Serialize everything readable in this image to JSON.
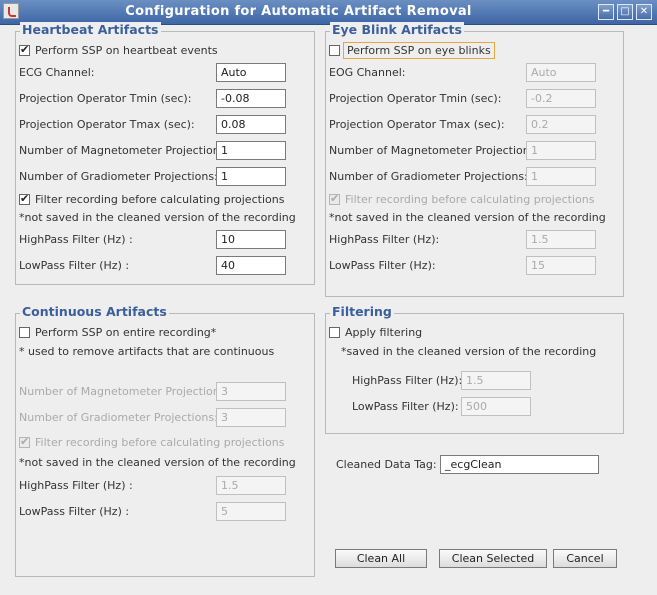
{
  "window": {
    "title": "Configuration for Automatic Artifact Removal"
  },
  "heartbeat": {
    "title": "Heartbeat Artifacts",
    "perform_label": "Perform SSP on heartbeat events",
    "ecg_channel_label": "ECG Channel:",
    "ecg_channel_value": "Auto",
    "tmin_label": "Projection Operator Tmin (sec):",
    "tmin_value": "-0.08",
    "tmax_label": "Projection Operator Tmax (sec):",
    "tmax_value": "0.08",
    "mag_label": "Number of Magnetometer Projections:",
    "mag_value": "1",
    "grad_label": "Number of Gradiometer Projections:",
    "grad_value": "1",
    "filter_label": "Filter recording before calculating projections",
    "note": "*not saved in the cleaned version of the recording",
    "highpass_label": "HighPass Filter (Hz) :",
    "highpass_value": "10",
    "lowpass_label": "LowPass Filter (Hz) :",
    "lowpass_value": "40"
  },
  "eyeblink": {
    "title": "Eye Blink Artifacts",
    "perform_label": "Perform SSP on eye blinks",
    "eog_channel_label": "EOG Channel:",
    "eog_channel_value": "Auto",
    "tmin_label": "Projection Operator Tmin (sec):",
    "tmin_value": "-0.2",
    "tmax_label": "Projection Operator Tmax (sec):",
    "tmax_value": "0.2",
    "mag_label": "Number of Magnetometer Projections:",
    "mag_value": "1",
    "grad_label": "Number of Gradiometer Projections:",
    "grad_value": "1",
    "filter_label": "Filter recording before calculating projections",
    "note": "*not saved in the cleaned version of the recording",
    "highpass_label": "HighPass Filter (Hz):",
    "highpass_value": "1.5",
    "lowpass_label": "LowPass Filter (Hz):",
    "lowpass_value": "15"
  },
  "continuous": {
    "title": "Continuous Artifacts",
    "perform_label": "Perform SSP on entire recording*",
    "used_note": "* used to remove artifacts that are continuous",
    "mag_label": "Number of Magnetometer Projections:",
    "mag_value": "3",
    "grad_label": "Number of Gradiometer Projections:",
    "grad_value": "3",
    "filter_label": "Filter recording before calculating projections",
    "note": "*not saved in the cleaned version of the recording",
    "highpass_label": "HighPass Filter (Hz) :",
    "highpass_value": "1.5",
    "lowpass_label": "LowPass Filter (Hz) :",
    "lowpass_value": "5"
  },
  "filtering": {
    "title": "Filtering",
    "apply_label": "Apply filtering",
    "note": "*saved in the cleaned version of the recording",
    "highpass_label": "HighPass Filter (Hz):",
    "highpass_value": "1.5",
    "lowpass_label": "LowPass Filter (Hz):",
    "lowpass_value": "500"
  },
  "tag": {
    "label": "Cleaned Data Tag:",
    "value": "_ecgClean"
  },
  "buttons": {
    "clean_all": "Clean All",
    "clean_selected": "Clean Selected",
    "cancel": "Cancel"
  }
}
